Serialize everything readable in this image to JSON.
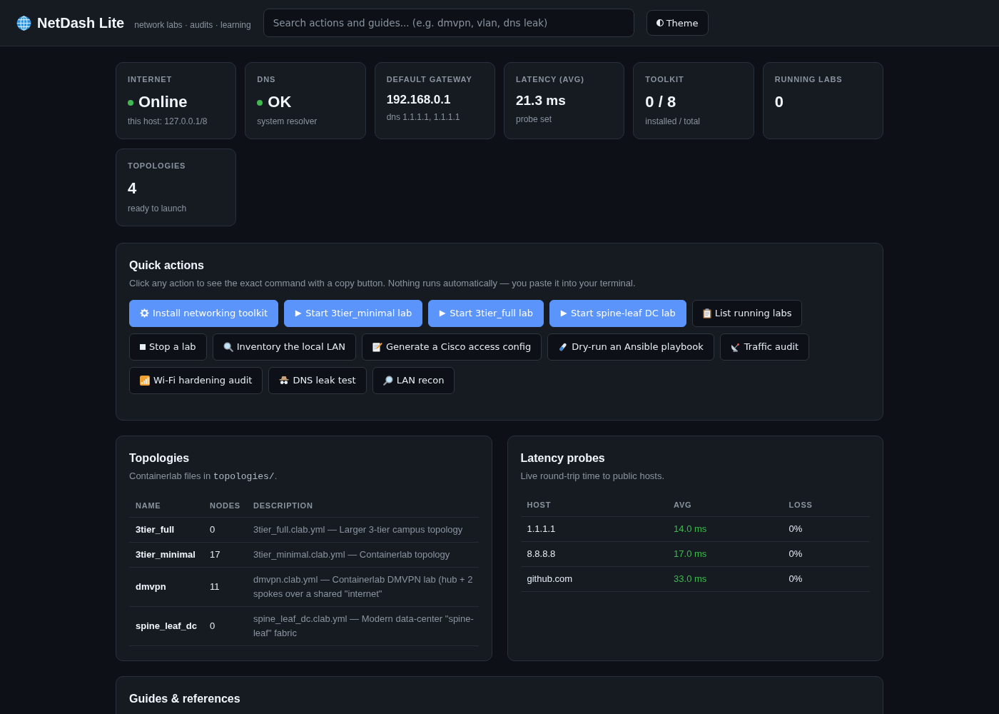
{
  "header": {
    "title": "NetDash Lite",
    "tagline": "network labs · audits · learning",
    "search": {
      "placeholder": "Search actions and guides... (e.g. dmvpn, vlan, dns leak)"
    },
    "theme_button": "Theme"
  },
  "stats": [
    {
      "label": "INTERNET",
      "value": "Online",
      "status_dot": true,
      "detail": "this host: 127.0.0.1/8"
    },
    {
      "label": "DNS",
      "value": "OK",
      "status_dot": true,
      "detail": "system resolver"
    },
    {
      "label": "DEFAULT GATEWAY",
      "value": "192.168.0.1",
      "status_dot": false,
      "detail": "dns 1.1.1.1, 1.1.1.1"
    },
    {
      "label": "LATENCY (AVG)",
      "value": "21.3 ms",
      "status_dot": false,
      "detail": "probe set"
    },
    {
      "label": "TOOLKIT",
      "value": "0 / 8",
      "status_dot": false,
      "detail": "installed / total"
    },
    {
      "label": "RUNNING LABS",
      "value": "0",
      "status_dot": false
    },
    {
      "label": "TOPOLOGIES",
      "value": "4",
      "status_dot": false,
      "detail": "ready to launch"
    }
  ],
  "quick_actions": {
    "title": "Quick actions",
    "description": "Click any action to see the exact command with a copy button. Nothing runs automatically — you paste it into your terminal.",
    "actions": [
      {
        "label": "Install networking toolkit",
        "primary": true
      },
      {
        "label": "Start 3tier_minimal lab",
        "primary": true
      },
      {
        "label": "Start 3tier_full lab",
        "primary": true
      },
      {
        "label": "Start spine-leaf DC lab",
        "primary": true
      },
      {
        "label": "List running labs",
        "primary": false
      },
      {
        "label": "Stop a lab",
        "primary": false
      },
      {
        "label": "Inventory the local LAN",
        "primary": false
      },
      {
        "label": "Generate a Cisco access config",
        "primary": false
      },
      {
        "label": "Dry-run an Ansible playbook",
        "primary": false
      },
      {
        "label": "Traffic audit",
        "primary": false
      },
      {
        "label": "Wi-Fi hardening audit",
        "primary": false
      },
      {
        "label": "DNS leak test",
        "primary": false
      },
      {
        "label": "LAN recon",
        "primary": false
      }
    ]
  },
  "topologies": {
    "title": "Topologies",
    "subtitle": {
      "before": "Containerlab files in",
      "code": "topologies/",
      "after": "."
    },
    "table": {
      "columns": [
        "NAME",
        "NODES",
        "DESCRIPTION"
      ],
      "rows": [
        {
          "name": "3tier_full",
          "nodes": "0",
          "description": "3tier_full.clab.yml — Larger 3-tier campus topology"
        },
        {
          "name": "3tier_minimal",
          "nodes": "17",
          "description": "3tier_minimal.clab.yml — Containerlab topology"
        },
        {
          "name": "dmvpn",
          "nodes": "11",
          "description": "dmvpn.clab.yml — Containerlab DMVPN lab (hub + 2 spokes over a shared \"internet\""
        },
        {
          "name": "spine_leaf_dc",
          "nodes": "0",
          "description": "spine_leaf_dc.clab.yml — Modern data-center \"spine-leaf\" fabric"
        }
      ]
    }
  },
  "latency": {
    "title": "Latency probes",
    "subtitle": "Live round-trip time to public hosts.",
    "table": {
      "columns": [
        "HOST",
        "AVG",
        "LOSS"
      ],
      "rows": [
        {
          "host": "1.1.1.1",
          "avg": "14.0 ms",
          "color": "#3fb950",
          "loss": "0%"
        },
        {
          "host": "8.8.8.8",
          "avg": "17.0 ms",
          "color": "#3fb950",
          "loss": "0%"
        },
        {
          "host": "github.com",
          "avg": "33.0 ms",
          "color": "#3fb950",
          "loss": "0%"
        }
      ]
    }
  },
  "guides": {
    "title": "Guides & references"
  }
}
